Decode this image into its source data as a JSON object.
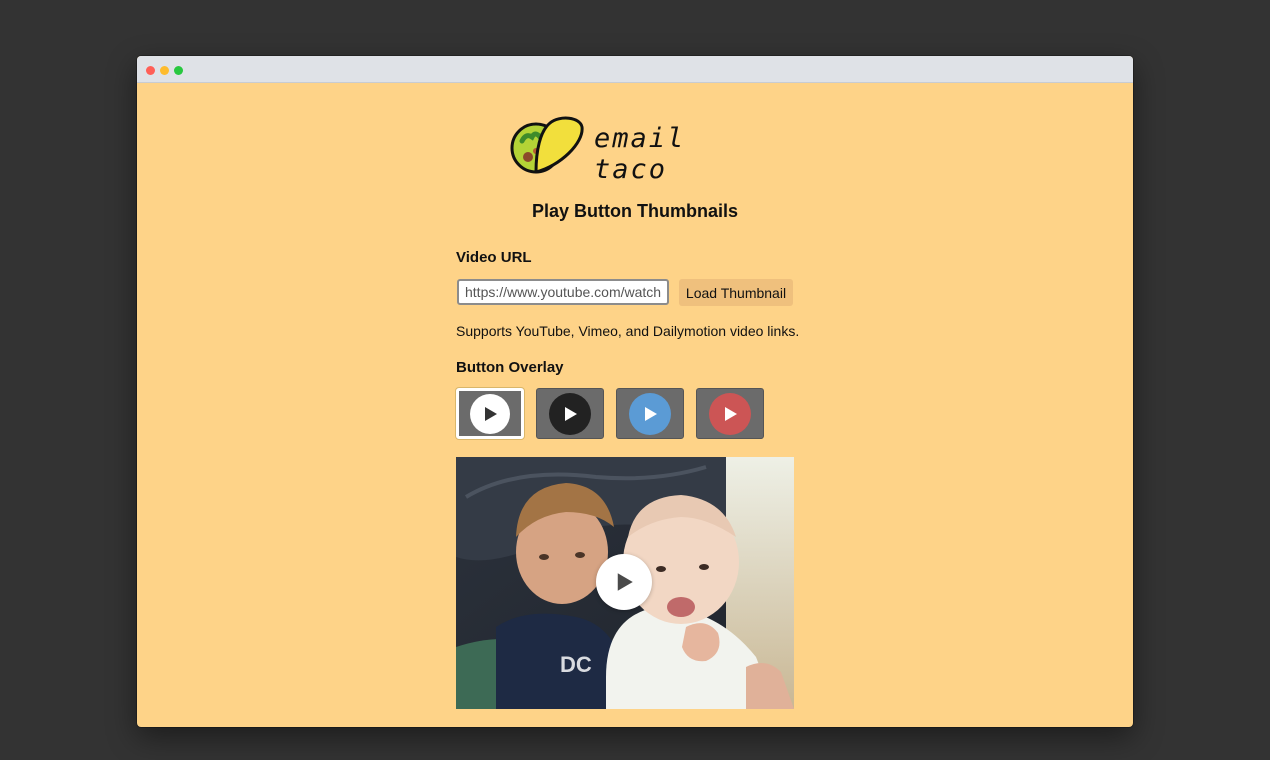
{
  "brand": {
    "name": "email taco"
  },
  "page": {
    "title": "Play Button Thumbnails"
  },
  "video_url": {
    "label": "Video URL",
    "placeholder": "https://www.youtube.com/watch?v=",
    "load_button": "Load Thumbnail",
    "support_text": "Supports YouTube, Vimeo, and Dailymotion video links."
  },
  "overlay": {
    "label": "Button Overlay",
    "options": [
      {
        "icon": "play-icon",
        "circle_color": "#ffffff",
        "triangle_color": "#333333",
        "selected": true
      },
      {
        "icon": "play-icon",
        "circle_color": "#222222",
        "triangle_color": "#ffffff",
        "selected": false
      },
      {
        "icon": "play-icon",
        "circle_color": "#5b9bd5",
        "triangle_color": "#ffffff",
        "selected": false
      },
      {
        "icon": "play-icon",
        "circle_color": "#cc5555",
        "triangle_color": "#ffffff",
        "selected": false
      }
    ]
  },
  "preview": {
    "overlay_icon": "play-icon"
  },
  "colors": {
    "page_background": "#fed388",
    "button_background": "#efc07d",
    "option_background": "#6b6b6b"
  }
}
